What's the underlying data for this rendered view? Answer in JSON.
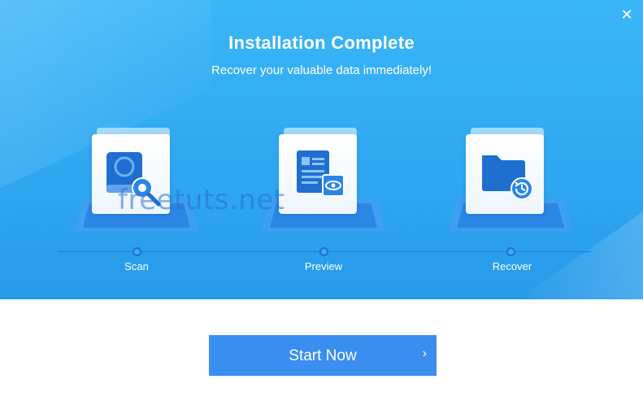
{
  "window": {
    "close_glyph": "✕"
  },
  "header": {
    "title": "Installation Complete",
    "subtitle": "Recover your valuable data immediately!"
  },
  "steps": [
    {
      "label": "Scan",
      "icon": "drive-search-icon"
    },
    {
      "label": "Preview",
      "icon": "document-preview-icon"
    },
    {
      "label": "Recover",
      "icon": "folder-restore-icon"
    }
  ],
  "watermark": "freetuts.net",
  "action": {
    "start_label": "Start Now",
    "chevron": "›"
  },
  "colors": {
    "hero_blue": "#2fa8f1",
    "accent_blue": "#3a8ef0",
    "icon_blue": "#1f6fd1"
  }
}
